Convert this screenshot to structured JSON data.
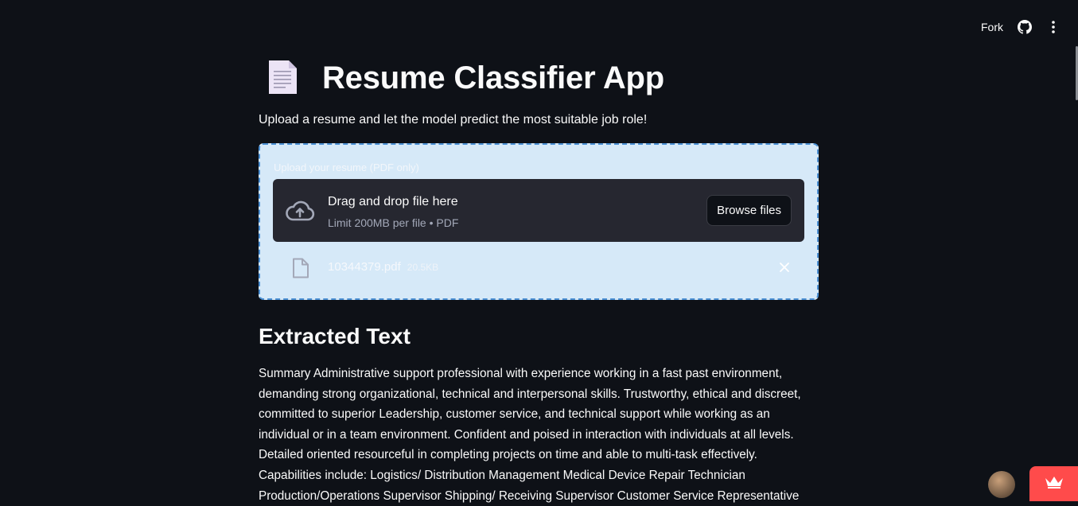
{
  "toolbar": {
    "fork_label": "Fork",
    "github_icon": "github-icon",
    "menu_icon": "kebab-menu-icon"
  },
  "header": {
    "icon": "page-document-emoji",
    "title": "Resume Classifier App"
  },
  "subtitle": "Upload a resume and let the model predict the most suitable job role!",
  "uploader": {
    "label": "Upload your resume (PDF only)",
    "drop_text": "Drag and drop file here",
    "limit_text": "Limit 200MB per file • PDF",
    "browse_label": "Browse files",
    "file": {
      "name": "10344379.pdf",
      "size": "20.5KB"
    }
  },
  "extracted": {
    "heading": "Extracted Text",
    "lines": [
      "Summary Administrative support professional with experience working in a fast past environment,",
      "demanding strong organizational, technical and interpersonal skills. Trustworthy, ethical and discreet,",
      "committed to superior Leadership, customer service, and technical support while working as an",
      "individual or in a team environment. Confident and poised in interaction with individuals at all levels.",
      "Detailed oriented resourceful in completing projects on time and able to multi-task effectively.",
      "Capabilities include: Logistics/ Distribution Management Medical Device Repair Technician",
      "Production/Operations Supervisor Shipping/ Receiving Supervisor Customer Service Representative"
    ]
  },
  "colors": {
    "background": "#0e1117",
    "uploader_bg": "#d6e9f8",
    "dropzone_bg": "#262730",
    "accent": "#ff4b4b"
  }
}
